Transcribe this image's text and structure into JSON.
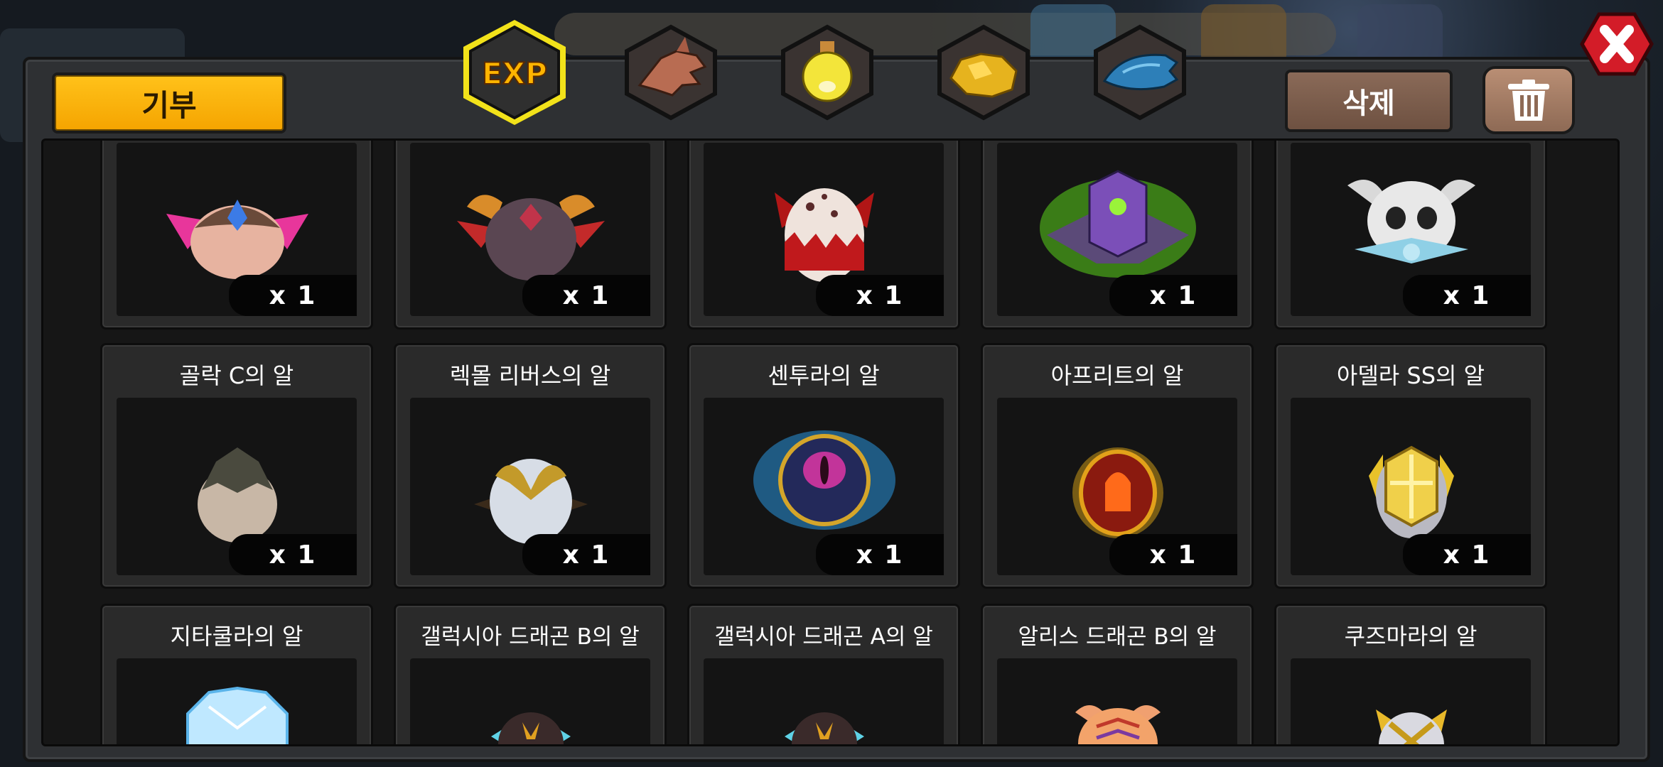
{
  "toolbar": {
    "donate_label": "기부",
    "delete_label": "삭제"
  },
  "tabs": [
    {
      "id": "exp",
      "label": "EXP",
      "active": true
    },
    {
      "id": "dragon",
      "icon": "dragon-head-icon",
      "active": false
    },
    {
      "id": "potion",
      "icon": "potion-icon",
      "active": false
    },
    {
      "id": "gold",
      "icon": "gold-ore-icon",
      "active": false
    },
    {
      "id": "scale",
      "icon": "dragon-scale-icon",
      "active": false
    }
  ],
  "colors": {
    "accent": "#ffb300",
    "active_tab_border": "#f5e400",
    "delete_button": "#7a5c4b",
    "close_button": "#d31c28"
  },
  "rows": [
    [
      {
        "title": "",
        "qty": "x 1",
        "egg": "pink-crown-egg-icon"
      },
      {
        "title": "",
        "qty": "x 1",
        "egg": "horned-dark-egg-icon"
      },
      {
        "title": "",
        "qty": "x 1",
        "egg": "spotted-red-egg-icon"
      },
      {
        "title": "",
        "qty": "x 1",
        "egg": "purple-green-egg-icon"
      },
      {
        "title": "",
        "qty": "x 1",
        "egg": "skull-egg-icon"
      }
    ],
    [
      {
        "title": "골락 C의 알",
        "qty": "x 1",
        "egg": "spiked-stone-egg-icon"
      },
      {
        "title": "렉몰 리버스의 알",
        "qty": "x 1",
        "egg": "white-horned-egg-icon"
      },
      {
        "title": "센투라의 알",
        "qty": "x 1",
        "egg": "blue-eye-egg-icon"
      },
      {
        "title": "아프리트의 알",
        "qty": "x 1",
        "egg": "fire-egg-icon"
      },
      {
        "title": "아델라 SS의 알",
        "qty": "x 1",
        "egg": "gold-armored-egg-icon"
      }
    ],
    [
      {
        "title": "지타쿨라의 알",
        "egg": "ice-crystal-egg-icon"
      },
      {
        "title": "갤럭시아 드래곤 B의 알",
        "egg": "galaxy-b-egg-icon"
      },
      {
        "title": "갤럭시아 드래곤 A의 알",
        "egg": "galaxy-a-egg-icon"
      },
      {
        "title": "알리스 드래곤 B의 알",
        "egg": "alice-b-egg-icon"
      },
      {
        "title": "쿠즈마라의 알",
        "egg": "kuzmara-egg-icon"
      }
    ]
  ]
}
